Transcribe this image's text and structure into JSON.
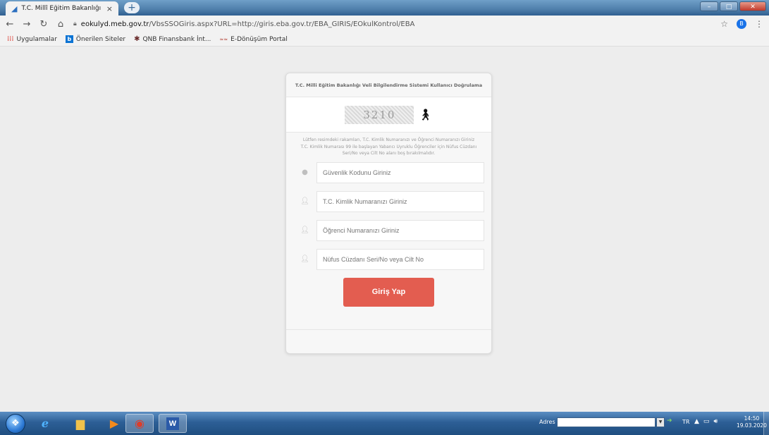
{
  "browser": {
    "tab_title": "T.C. Millî Eğitim Bakanlığı",
    "tab_close": "×",
    "new_tab": "+",
    "url_host": "eokulyd.meb.gov.tr",
    "url_path": "/VbsSSOGiris.aspx?URL=http://giris.eba.gov.tr/EBA_GIRIS/EOkulKontrol/EBA",
    "profile_initial": "B",
    "bookmarks": [
      {
        "label": "Uygulamalar",
        "icon": "apps-grid-icon"
      },
      {
        "label": "Önerilen Siteler",
        "icon": "bing-icon"
      },
      {
        "label": "QNB Finansbank İnt...",
        "icon": "qnb-icon"
      },
      {
        "label": "E-Dönüşüm Portal",
        "icon": "edonusum-icon"
      }
    ]
  },
  "login": {
    "header": "T.C. Milli Eğitim Bakanlığı Veli Bilgilendirme Sistemi Kullanıcı Doğrulama",
    "captcha_text": "3210",
    "instructions_line1": "Lütfen resimdeki rakamları, T.C. Kimlik Numaranızı ve Öğrenci Numaranızı Giriniz",
    "instructions_line2": "T.C. Kimlik Numarası 99 ile başlayan Yabancı Uyruklu Öğrenciler için Nüfus Cüzdanı Seri/No veya Cilt No alanı boş bırakılmalıdır.",
    "fields": {
      "security_code_placeholder": "Güvenlik Kodunu Giriniz",
      "tc_id_placeholder": "T.C. Kimlik Numaranızı Giriniz",
      "student_no_placeholder": "Öğrenci Numaranızı Giriniz",
      "id_card_placeholder": "Nüfus Cüzdanı Seri/No veya Cilt No"
    },
    "submit_label": "Giriş Yap"
  },
  "taskbar": {
    "address_label": "Adres",
    "language": "TR",
    "time": "14:50",
    "date": "19.03.2020"
  },
  "colors": {
    "button": "#e35d50",
    "page_bg": "#ededed"
  }
}
